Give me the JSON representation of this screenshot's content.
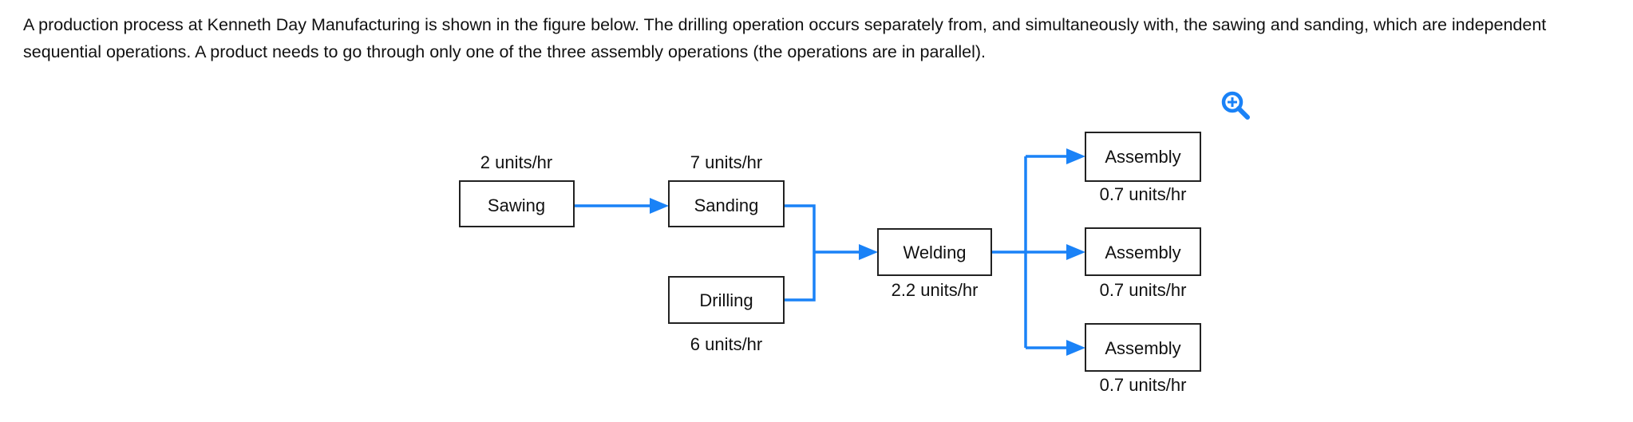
{
  "question": {
    "text": "A production process at Kenneth Day Manufacturing is shown in the figure below. The drilling operation occurs separately from, and simultaneously with, the sawing and sanding, which are independent sequential operations. A product needs to go through only one of the three assembly operations (the operations are in parallel)."
  },
  "zoom_icon": "zoom-in-icon",
  "accent_color": "#1a82f7",
  "diagram": {
    "nodes": [
      {
        "name": "Sawing",
        "rate": "2 units/hr"
      },
      {
        "name": "Sanding",
        "rate": "7 units/hr"
      },
      {
        "name": "Drilling",
        "rate": "6 units/hr"
      },
      {
        "name": "Welding",
        "rate": "2.2 units/hr"
      },
      {
        "name": "Assembly",
        "rate": "0.7 units/hr"
      },
      {
        "name": "Assembly",
        "rate": "0.7 units/hr"
      },
      {
        "name": "Assembly",
        "rate": "0.7 units/hr"
      }
    ]
  }
}
